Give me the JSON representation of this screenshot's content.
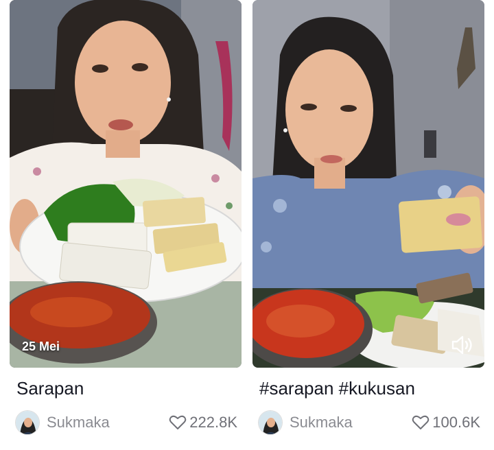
{
  "cards": [
    {
      "title": "Sarapan",
      "date_badge": "25 Mei",
      "author": "Sukmaka",
      "likes": "222.8K",
      "thumbnail_subject": "woman-holding-plate-of-vegetables-tofu-tempeh"
    },
    {
      "title": "#sarapan #kukusan",
      "author": "Sukmaka",
      "likes": "100.6K",
      "thumbnail_subject": "woman-holding-tempeh-with-sambal",
      "sound_icon": "speaker-icon"
    }
  ],
  "colors": {
    "text_primary": "#161823",
    "text_secondary": "#8a8b91",
    "background": "#ffffff"
  }
}
